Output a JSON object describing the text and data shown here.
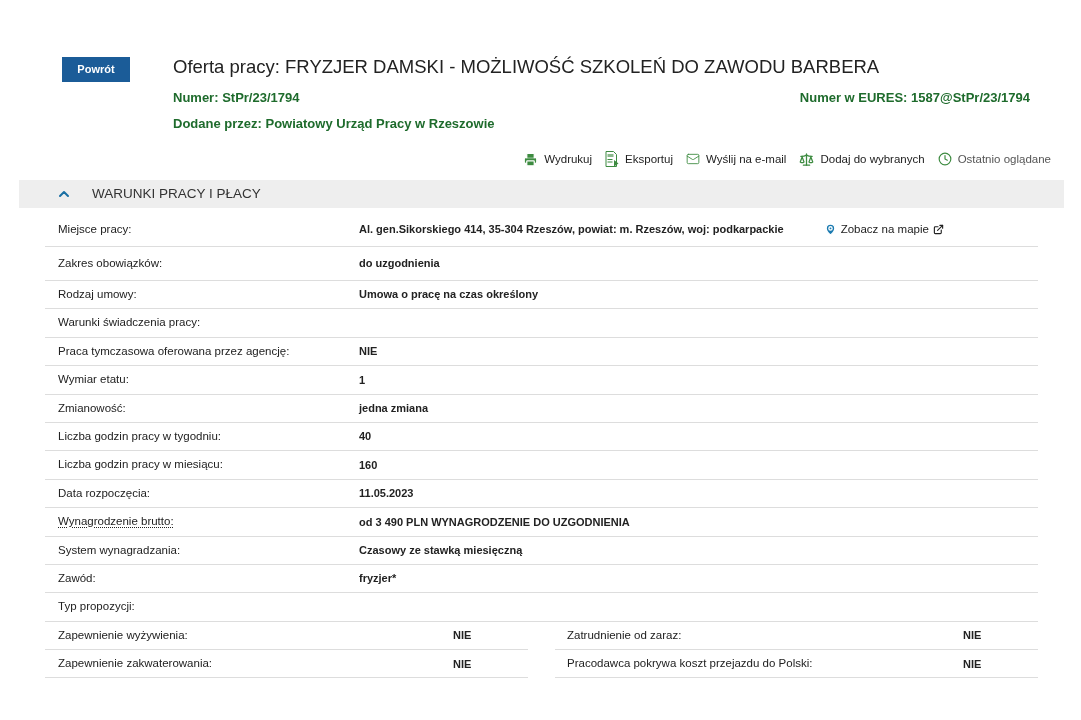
{
  "back_button": "Powrót",
  "title": "Oferta pracy: FRYZJER DAMSKI - MOŻLIWOŚĆ SZKOLEŃ DO ZAWODU BARBERA",
  "number": {
    "label": "Numer:",
    "value": "StPr/23/1794"
  },
  "eures_number": {
    "label": "Numer w EURES:",
    "value": "1587@StPr/23/1794"
  },
  "added_by": {
    "label": "Dodane przez:",
    "value": "Powiatowy Urząd Pracy w Rzeszowie"
  },
  "actions": [
    {
      "kind": "print",
      "label": "Wydrukuj"
    },
    {
      "kind": "export",
      "label": "Eksportuj"
    },
    {
      "kind": "email",
      "label": "Wyślij na e-mail"
    },
    {
      "kind": "compare",
      "label": "Dodaj do wybranych"
    },
    {
      "kind": "history",
      "label": "Ostatnio oglądane"
    }
  ],
  "section": {
    "title": "WARUNKI PRACY I PŁACY",
    "expanded": true,
    "rows": [
      {
        "label": "Miejsce pracy:",
        "value": "Al. gen.Sikorskiego 414, 35-304 Rzeszów, powiat: m. Rzeszów, woj: podkarpackie",
        "link": "Zobacz na mapie",
        "underlined": false
      },
      {
        "label": "Zakres obowiązków:",
        "value": "do uzgodnienia",
        "underlined": false
      },
      {
        "label": "Rodzaj umowy:",
        "value": "Umowa o pracę na czas określony",
        "underlined": false
      },
      {
        "label": "Warunki świadczenia pracy:",
        "underlined": false
      },
      {
        "label": "Praca tymczasowa oferowana przez agencję:",
        "value": "NIE",
        "underlined": false
      },
      {
        "label": "Wymiar etatu:",
        "value": "1",
        "underlined": false
      },
      {
        "label": "Zmianowość:",
        "value": "jedna zmiana",
        "underlined": false
      },
      {
        "label": "Liczba godzin pracy w tygodniu:",
        "value": "40",
        "underlined": false
      },
      {
        "label": "Liczba godzin pracy w miesiącu:",
        "value": "160",
        "underlined": false
      },
      {
        "label": "Data rozpoczęcia:",
        "value": "11.05.2023",
        "underlined": false
      },
      {
        "label": "Wynagrodzenie brutto:",
        "value": "od 3 490 PLN WYNAGRODZENIE DO UZGODNIENIA",
        "underlined": true
      },
      {
        "label": "System wynagradzania:",
        "value": "Czasowy ze stawką miesięczną",
        "underlined": false
      },
      {
        "label": "Zawód:",
        "value": "fryzjer*",
        "underlined": false
      },
      {
        "label": "Typ propozycji:",
        "underlined": false
      }
    ],
    "paired_rows": [
      [
        {
          "label": "Zapewnienie wyżywienia:",
          "value": "NIE"
        },
        {
          "label": "Zatrudnienie od zaraz:",
          "value": "NIE"
        }
      ],
      [
        {
          "label": "Zapewnienie zakwaterowania:",
          "value": "NIE"
        },
        {
          "label": "Pracodawca pokrywa koszt przejazdu do Polski:",
          "value": "NIE"
        }
      ]
    ]
  }
}
